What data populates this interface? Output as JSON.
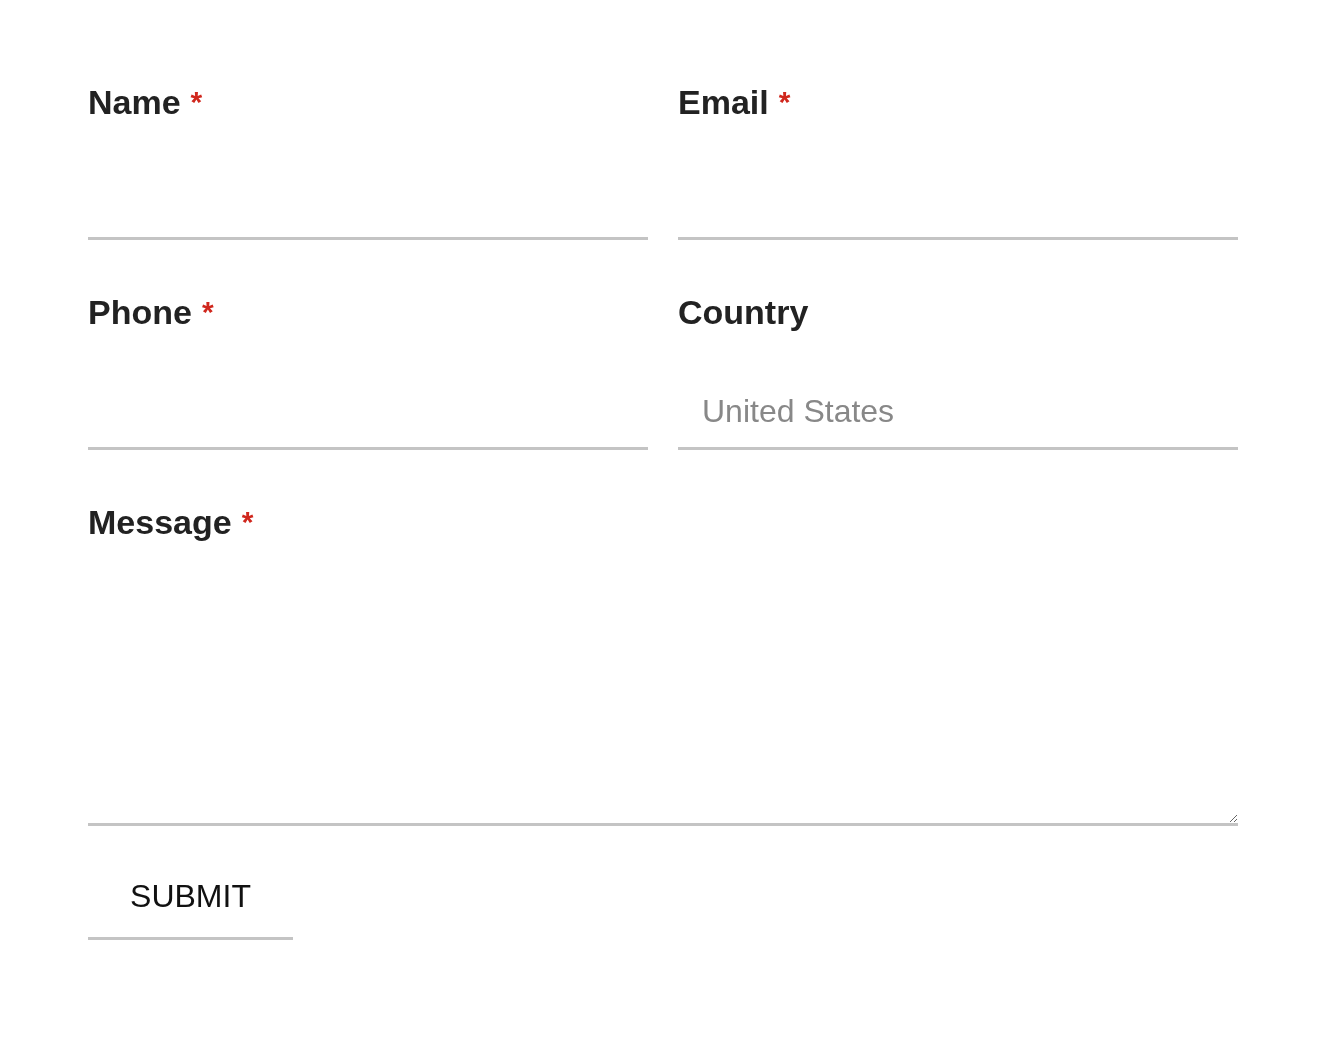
{
  "required_mark": "*",
  "fields": [
    {
      "kind": "input",
      "label": "Name",
      "required": true
    },
    {
      "kind": "input",
      "label": "Email",
      "required": true
    },
    {
      "kind": "input",
      "label": "Phone",
      "required": true
    },
    {
      "kind": "input",
      "label": "Country",
      "required": false,
      "placeholder": "United States"
    },
    {
      "kind": "textarea",
      "label": "Message",
      "required": true
    }
  ],
  "submit": {
    "label": "SUBMIT"
  }
}
